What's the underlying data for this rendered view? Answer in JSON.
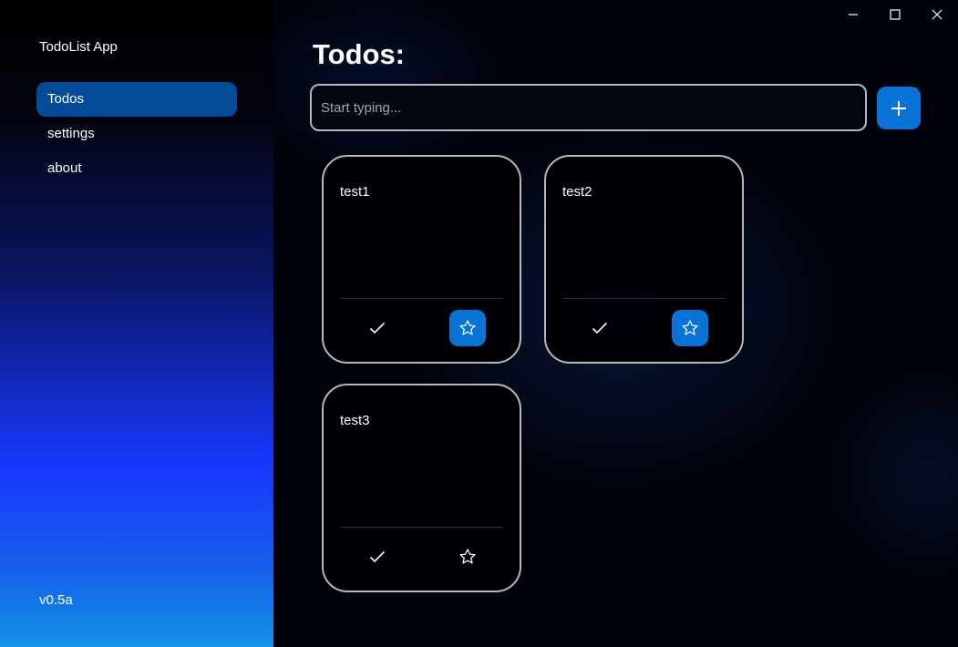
{
  "app": {
    "title": "TodoList App",
    "version": "v0.5a"
  },
  "sidebar": {
    "items": [
      {
        "label": "Todos",
        "active": true
      },
      {
        "label": "settings",
        "active": false
      },
      {
        "label": "about",
        "active": false
      }
    ]
  },
  "main": {
    "title": "Todos:",
    "input": {
      "placeholder": "Start typing...",
      "value": ""
    },
    "todos": [
      {
        "title": "test1",
        "starred": true
      },
      {
        "title": "test2",
        "starred": true
      },
      {
        "title": "test3",
        "starred": false
      }
    ]
  },
  "icons": {
    "add": "plus-icon",
    "complete": "check-icon",
    "favorite": "star-icon",
    "minimize": "minimize-icon",
    "maximize": "maximize-icon",
    "close": "close-icon"
  },
  "colors": {
    "accent": "#0a74d6",
    "nav_active": "#034a97",
    "card_border": "#b8b8b8"
  }
}
